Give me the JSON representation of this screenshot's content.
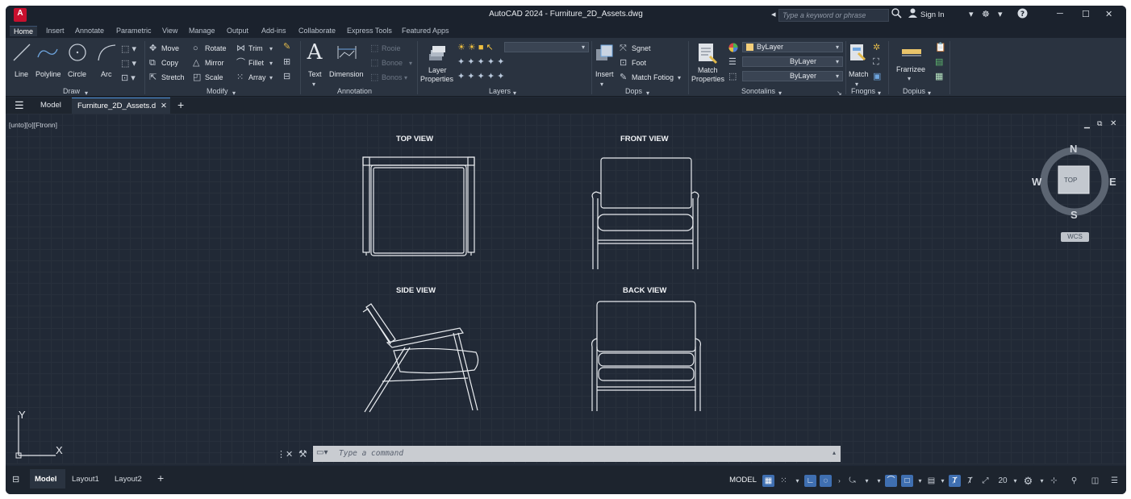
{
  "titlebar": {
    "app_logo": "A",
    "title": "AutoCAD 2024 - Furniture_2D_Assets.dwg",
    "search_placeholder": "Type a keyword or phrase",
    "sign_in": "Sign In"
  },
  "ribbon_tabs": [
    "Home",
    "Insert",
    "Annotate",
    "Parametric",
    "View",
    "Manage",
    "Output",
    "Add-ins",
    "Collaborate",
    "Express Tools",
    "Featured Apps"
  ],
  "ribbon": {
    "draw": {
      "title": "Draw",
      "line": "Line",
      "polyline": "Polyline",
      "circle": "Circle",
      "arc": "Arc"
    },
    "modify": {
      "title": "Modify",
      "move": "Move",
      "rotate": "Rotate",
      "trim": "Trim",
      "copy": "Copy",
      "mirror": "Mirror",
      "fillet": "Fillet",
      "stretch": "Stretch",
      "scale": "Scale",
      "array": "Array"
    },
    "annotation": {
      "title": "Annotation",
      "text": "Text",
      "dimension": "Dimension",
      "r1": "Rooie",
      "r2": "Bonoe",
      "r3": "Bonos"
    },
    "layers": {
      "title": "Layers",
      "layer_properties_1": "Layer",
      "layer_properties_2": "Properties"
    },
    "dops": {
      "title": "Dops",
      "insert": "Insert",
      "item1": "Sgnet",
      "item2": "Foot",
      "item3": "Match Fotiog"
    },
    "sonotalins": {
      "title": "Sonotalins",
      "match_properties_1": "Match",
      "match_properties_2": "Properties",
      "bylayer1": "ByLayer",
      "bylayer2": "ByLayer",
      "bylayer3": "ByLayer"
    },
    "fnogns": {
      "title": "Fnogns",
      "match": "Match"
    },
    "dopius": {
      "title": "Dopius",
      "frarrizee": "Frarrizee"
    }
  },
  "filetabs": {
    "model": "Model",
    "file": "Furniture_2D_Assets.d"
  },
  "canvas": {
    "view_label": "[unto][o][Ftronn]",
    "views": {
      "top": "TOP VIEW",
      "front": "FRONT VIEW",
      "side": "SIDE VIEW",
      "back": "BACK VIEW"
    },
    "viewcube": {
      "n": "N",
      "s": "S",
      "e": "E",
      "w": "W",
      "top": "TOP",
      "wcs": "WCS"
    },
    "ucs": {
      "y": "Y",
      "x": "X"
    }
  },
  "command": {
    "placeholder": "Type a command"
  },
  "statusbar": {
    "model_tab": "Model",
    "layout1": "Layout1",
    "layout2": "Layout2",
    "model_btn": "MODEL",
    "zoom": "20"
  }
}
